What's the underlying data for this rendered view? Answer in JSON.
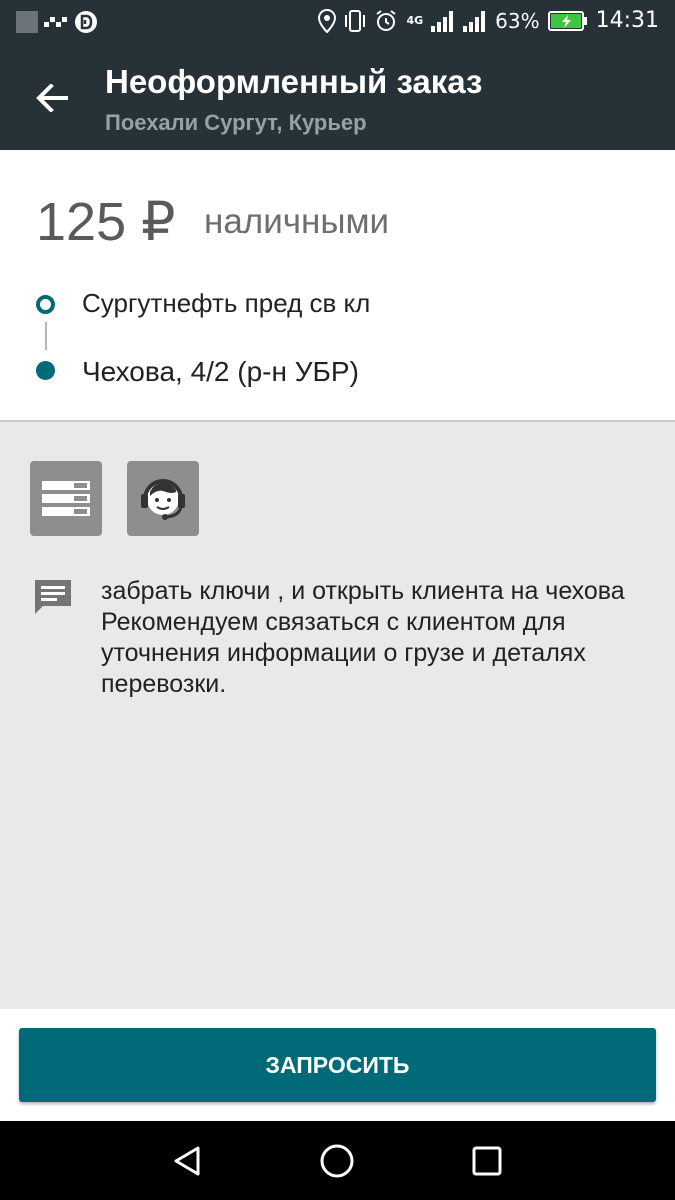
{
  "status_bar": {
    "battery_percent": "63%",
    "time": "14:31",
    "network_label": "4G",
    "icons": [
      "notification-icon",
      "dots-icon",
      "app-icon",
      "location-icon",
      "vibrate-icon",
      "alarm-icon",
      "signal-icon",
      "battery-icon"
    ]
  },
  "app_bar": {
    "title": "Неоформленный заказ",
    "subtitle": "Поехали Сургут, Курьер",
    "back_icon": "arrow-left-icon"
  },
  "order": {
    "price": "125 ₽",
    "payment_method": "наличными",
    "route": {
      "from": "Сургутнефть пред св кл",
      "to": "Чехова, 4/2 (р-н УБР)"
    }
  },
  "actions": {
    "icons": [
      "list-icon",
      "support-agent-icon"
    ]
  },
  "comment": {
    "icon": "comment-icon",
    "lines": [
      "забрать ключи , и открыть клиента на чехова",
      "Рекомендуем связаться с клиентом для уточнения информации о грузе и деталях перевозки."
    ]
  },
  "request_button": {
    "label": "ЗАПРОСИТЬ"
  },
  "nav_bar": {
    "icons": [
      "nav-back-icon",
      "nav-home-icon",
      "nav-recent-icon"
    ]
  },
  "colors": {
    "app_bar": "#263238",
    "accent": "#006a79",
    "background": "#e8e9eb",
    "icon_button": "#8e8e8e"
  }
}
